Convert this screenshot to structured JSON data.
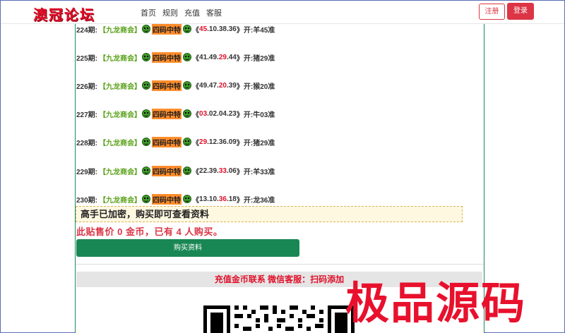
{
  "nav": {
    "logo": "澳冠论坛",
    "links": [
      "首页",
      "规则",
      "充值",
      "客服"
    ],
    "register": "注册",
    "login": "登录"
  },
  "records": [
    {
      "period": "224期:",
      "group": "【九龙商会】",
      "tag": "四码中特",
      "open": "《",
      "n1": "45",
      "rest": ".10.38.36",
      "highlight": "first",
      "close": "》",
      "result": "开:羊45准"
    },
    {
      "period": "225期:",
      "group": "【九龙商会】",
      "tag": "四码中特",
      "open": "《",
      "pre": "41.49.",
      "red": "29",
      "post": ".44",
      "close": "》",
      "result": "开:猪29准"
    },
    {
      "period": "226期:",
      "group": "【九龙商会】",
      "tag": "四码中特",
      "open": "《",
      "pre": "49.47.",
      "red": "20",
      "post": ".39",
      "close": "》",
      "result": "开:猴20准"
    },
    {
      "period": "227期:",
      "group": "【九龙商会】",
      "tag": "四码中特",
      "open": "《",
      "pre": "",
      "red": "03",
      "post": ".02.04.23",
      "close": "》",
      "result": "开:牛03准"
    },
    {
      "period": "228期:",
      "group": "【九龙商会】",
      "tag": "四码中特",
      "open": "《",
      "pre": "",
      "red": "29",
      "post": ".12.36.09",
      "close": "》",
      "result": "开:猪29准"
    },
    {
      "period": "229期:",
      "group": "【九龙商会】",
      "tag": "四码中特",
      "open": "《",
      "pre": "22.39.",
      "red": "33",
      "post": ".06",
      "close": "》",
      "result": "开:羊33准"
    },
    {
      "period": "230期:",
      "group": "【九龙商会】",
      "tag": "四码中特",
      "open": "《",
      "pre": "13.10.",
      "red": "36",
      "post": ".18",
      "close": "》",
      "result": "开:龙36准"
    }
  ],
  "locked_notice": "高手已加密，购买即可查看资料",
  "price_line": "此贴售价 0 金币，已有 4 人购买。",
  "buy_button": "购买资料",
  "contact": "充值金币联系 微信客服：扫码添加",
  "watermark": "极品源码",
  "colors": {
    "brand_red": "#e0102a",
    "buy_green": "#198754",
    "group_green": "#5aa21a",
    "tag_orange": "#ff8c2a"
  }
}
